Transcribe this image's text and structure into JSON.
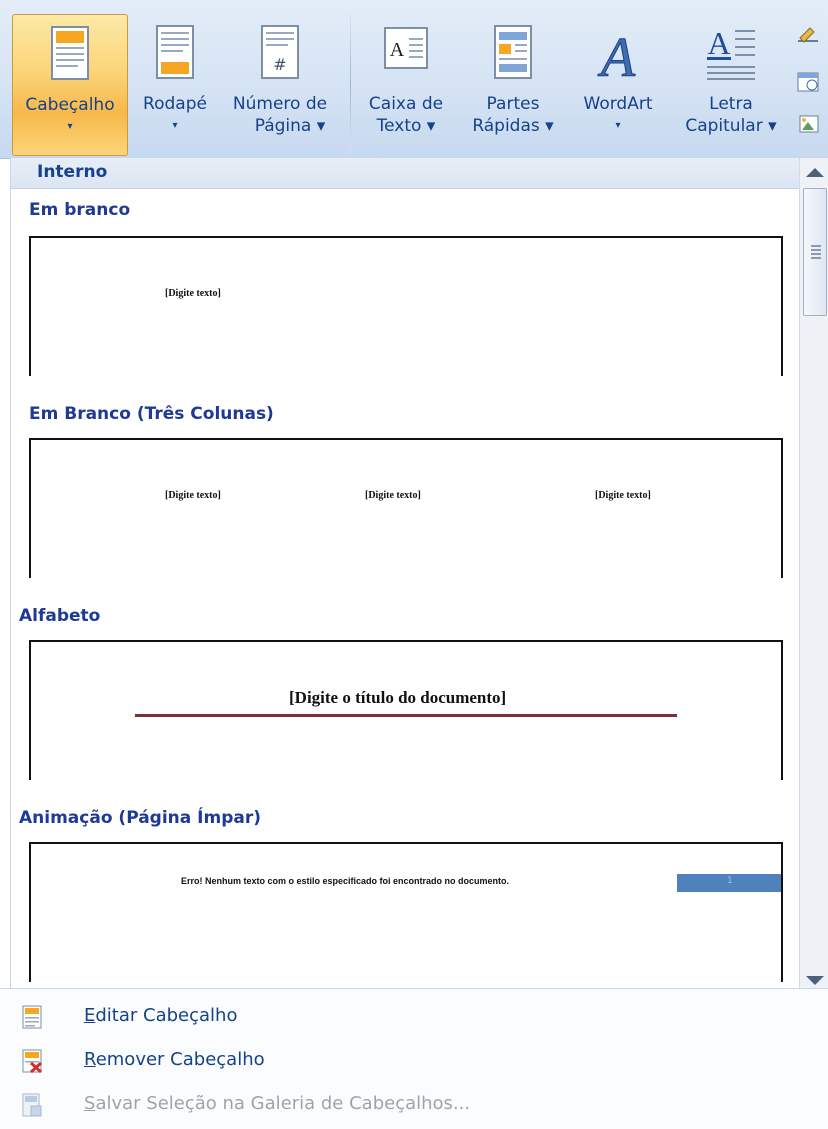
{
  "ribbon": {
    "buttons": [
      {
        "id": "cabecalho",
        "line1": "Cabeçalho",
        "line2": "▾",
        "active": true
      },
      {
        "id": "rodape",
        "line1": "Rodapé",
        "line2": "▾"
      },
      {
        "id": "numero",
        "line1": "Número de",
        "line2": "Página ▾"
      },
      {
        "id": "caixa",
        "line1": "Caixa de",
        "line2": "Texto ▾"
      },
      {
        "id": "partes",
        "line1": "Partes",
        "line2": "Rápidas ▾"
      },
      {
        "id": "wordart",
        "line1": "WordArt",
        "line2": "▾"
      },
      {
        "id": "letra",
        "line1": "Letra",
        "line2": "Capitular ▾"
      }
    ],
    "number_icon_glyph": "#",
    "textbox_icon_glyph": "A",
    "dropcap_icon_glyph": "A",
    "wordart_icon_glyph": "A",
    "accent_color": "#15428b",
    "active_color": "#fbd57a"
  },
  "gallery": {
    "section": "Interno",
    "items": [
      {
        "title": "Em branco",
        "placeholders": [
          "[Digite texto]"
        ]
      },
      {
        "title": "Em Branco (Três Colunas)",
        "placeholders": [
          "[Digite texto]",
          "[Digite texto]",
          "[Digite texto]"
        ]
      },
      {
        "title": "Alfabeto",
        "placeholders": [
          "[Digite o título do documento]"
        ]
      },
      {
        "title": "Animação (Página Ímpar)",
        "placeholders": [
          "Erro! Nenhum texto com o estilo especificado foi encontrado no documento.",
          "1"
        ]
      }
    ]
  },
  "menu": {
    "items": [
      {
        "first": "E",
        "rest": "ditar Cabeçalho",
        "enabled": true
      },
      {
        "first": "R",
        "rest": "emover Cabeçalho",
        "enabled": true
      },
      {
        "first": "S",
        "rest": "alvar Seleção na Galeria de Cabeçalhos...",
        "enabled": false
      }
    ]
  }
}
